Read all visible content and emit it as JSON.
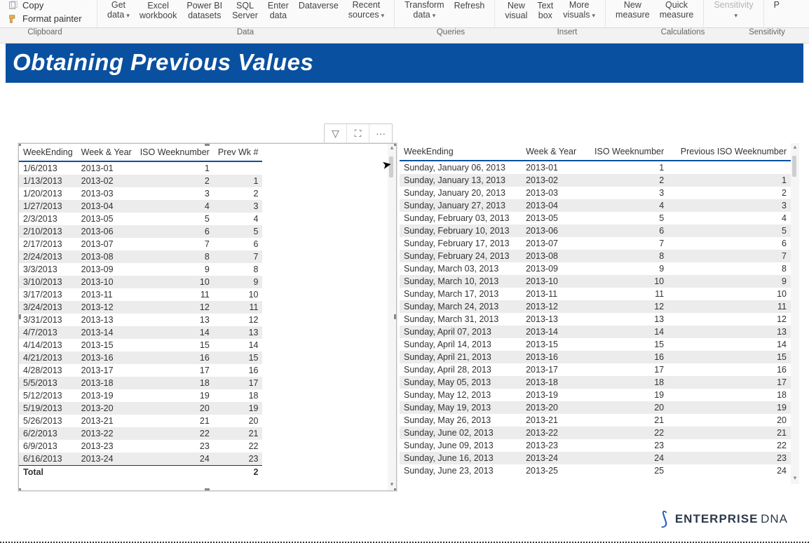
{
  "ribbon": {
    "copy_label": "Copy",
    "format_painter_label": "Format painter",
    "items": [
      {
        "line1": "Get",
        "line2": "data",
        "chev": true
      },
      {
        "line1": "Excel",
        "line2": "workbook"
      },
      {
        "line1": "Power BI",
        "line2": "datasets"
      },
      {
        "line1": "SQL",
        "line2": "Server"
      },
      {
        "line1": "Enter",
        "line2": "data"
      },
      {
        "line1": "Dataverse",
        "line2": ""
      },
      {
        "line1": "Recent",
        "line2": "sources",
        "chev": true
      }
    ],
    "queries": [
      {
        "line1": "Transform",
        "line2": "data",
        "chev": true
      },
      {
        "line1": "Refresh",
        "line2": ""
      }
    ],
    "insert": [
      {
        "line1": "New",
        "line2": "visual"
      },
      {
        "line1": "Text",
        "line2": "box"
      },
      {
        "line1": "More",
        "line2": "visuals",
        "chev": true
      }
    ],
    "calc": [
      {
        "line1": "New",
        "line2": "measure"
      },
      {
        "line1": "Quick",
        "line2": "measure"
      }
    ],
    "sensitivity": {
      "line1": "Sensitivity",
      "line2": "",
      "chev": true,
      "dim": true
    },
    "publish": {
      "line1": "P",
      "line2": ""
    }
  },
  "group_labels": {
    "clipboard": "Clipboard",
    "data": "Data",
    "queries": "Queries",
    "insert": "Insert",
    "calc": "Calculations",
    "sens": "Sensitivity"
  },
  "banner_title": "Obtaining Previous Values",
  "left_table": {
    "headers": [
      "WeekEnding",
      "Week & Year",
      "ISO Weeknumber",
      "Prev Wk #"
    ],
    "rows": [
      [
        "1/6/2013",
        "2013-01",
        "1",
        ""
      ],
      [
        "1/13/2013",
        "2013-02",
        "2",
        "1"
      ],
      [
        "1/20/2013",
        "2013-03",
        "3",
        "2"
      ],
      [
        "1/27/2013",
        "2013-04",
        "4",
        "3"
      ],
      [
        "2/3/2013",
        "2013-05",
        "5",
        "4"
      ],
      [
        "2/10/2013",
        "2013-06",
        "6",
        "5"
      ],
      [
        "2/17/2013",
        "2013-07",
        "7",
        "6"
      ],
      [
        "2/24/2013",
        "2013-08",
        "8",
        "7"
      ],
      [
        "3/3/2013",
        "2013-09",
        "9",
        "8"
      ],
      [
        "3/10/2013",
        "2013-10",
        "10",
        "9"
      ],
      [
        "3/17/2013",
        "2013-11",
        "11",
        "10"
      ],
      [
        "3/24/2013",
        "2013-12",
        "12",
        "11"
      ],
      [
        "3/31/2013",
        "2013-13",
        "13",
        "12"
      ],
      [
        "4/7/2013",
        "2013-14",
        "14",
        "13"
      ],
      [
        "4/14/2013",
        "2013-15",
        "15",
        "14"
      ],
      [
        "4/21/2013",
        "2013-16",
        "16",
        "15"
      ],
      [
        "4/28/2013",
        "2013-17",
        "17",
        "16"
      ],
      [
        "5/5/2013",
        "2013-18",
        "18",
        "17"
      ],
      [
        "5/12/2013",
        "2013-19",
        "19",
        "18"
      ],
      [
        "5/19/2013",
        "2013-20",
        "20",
        "19"
      ],
      [
        "5/26/2013",
        "2013-21",
        "21",
        "20"
      ],
      [
        "6/2/2013",
        "2013-22",
        "22",
        "21"
      ],
      [
        "6/9/2013",
        "2013-23",
        "23",
        "22"
      ],
      [
        "6/16/2013",
        "2013-24",
        "24",
        "23"
      ]
    ],
    "total_label": "Total",
    "total_value": "2"
  },
  "right_table": {
    "headers": [
      "WeekEnding",
      "Week & Year",
      "ISO Weeknumber",
      "Previous ISO Weeknumber"
    ],
    "rows": [
      [
        "Sunday, January 06, 2013",
        "2013-01",
        "1",
        ""
      ],
      [
        "Sunday, January 13, 2013",
        "2013-02",
        "2",
        "1"
      ],
      [
        "Sunday, January 20, 2013",
        "2013-03",
        "3",
        "2"
      ],
      [
        "Sunday, January 27, 2013",
        "2013-04",
        "4",
        "3"
      ],
      [
        "Sunday, February 03, 2013",
        "2013-05",
        "5",
        "4"
      ],
      [
        "Sunday, February 10, 2013",
        "2013-06",
        "6",
        "5"
      ],
      [
        "Sunday, February 17, 2013",
        "2013-07",
        "7",
        "6"
      ],
      [
        "Sunday, February 24, 2013",
        "2013-08",
        "8",
        "7"
      ],
      [
        "Sunday, March 03, 2013",
        "2013-09",
        "9",
        "8"
      ],
      [
        "Sunday, March 10, 2013",
        "2013-10",
        "10",
        "9"
      ],
      [
        "Sunday, March 17, 2013",
        "2013-11",
        "11",
        "10"
      ],
      [
        "Sunday, March 24, 2013",
        "2013-12",
        "12",
        "11"
      ],
      [
        "Sunday, March 31, 2013",
        "2013-13",
        "13",
        "12"
      ],
      [
        "Sunday, April 07, 2013",
        "2013-14",
        "14",
        "13"
      ],
      [
        "Sunday, April 14, 2013",
        "2013-15",
        "15",
        "14"
      ],
      [
        "Sunday, April 21, 2013",
        "2013-16",
        "16",
        "15"
      ],
      [
        "Sunday, April 28, 2013",
        "2013-17",
        "17",
        "16"
      ],
      [
        "Sunday, May 05, 2013",
        "2013-18",
        "18",
        "17"
      ],
      [
        "Sunday, May 12, 2013",
        "2013-19",
        "19",
        "18"
      ],
      [
        "Sunday, May 19, 2013",
        "2013-20",
        "20",
        "19"
      ],
      [
        "Sunday, May 26, 2013",
        "2013-21",
        "21",
        "20"
      ],
      [
        "Sunday, June 02, 2013",
        "2013-22",
        "22",
        "21"
      ],
      [
        "Sunday, June 09, 2013",
        "2013-23",
        "23",
        "22"
      ],
      [
        "Sunday, June 16, 2013",
        "2013-24",
        "24",
        "23"
      ],
      [
        "Sunday, June 23, 2013",
        "2013-25",
        "25",
        "24"
      ]
    ]
  },
  "toolbar_icons": {
    "filter": "▽",
    "focus": "⛶",
    "more": "···"
  },
  "logo": {
    "brand1": "ENTERPRISE",
    "brand2": "DNA"
  }
}
